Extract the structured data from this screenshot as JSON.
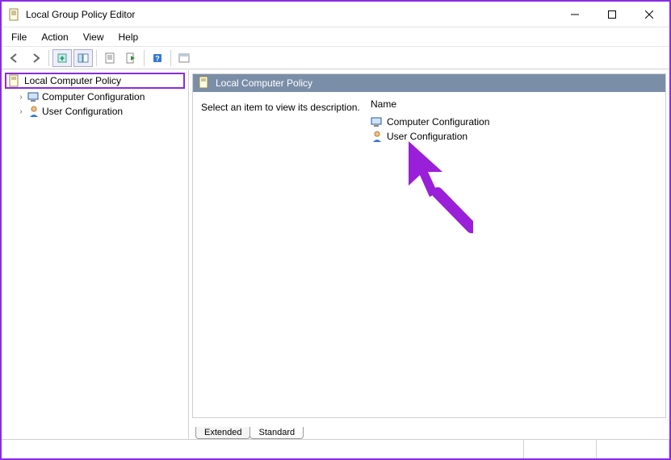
{
  "window": {
    "title": "Local Group Policy Editor"
  },
  "menu": {
    "file": "File",
    "action": "Action",
    "view": "View",
    "help": "Help"
  },
  "tree": {
    "root": "Local Computer Policy",
    "children": [
      "Computer Configuration",
      "User Configuration"
    ]
  },
  "detail": {
    "heading": "Local Computer Policy",
    "hint": "Select an item to view its description.",
    "column_name": "Name",
    "items": [
      "Computer Configuration",
      "User Configuration"
    ]
  },
  "tabs": {
    "extended": "Extended",
    "standard": "Standard"
  }
}
